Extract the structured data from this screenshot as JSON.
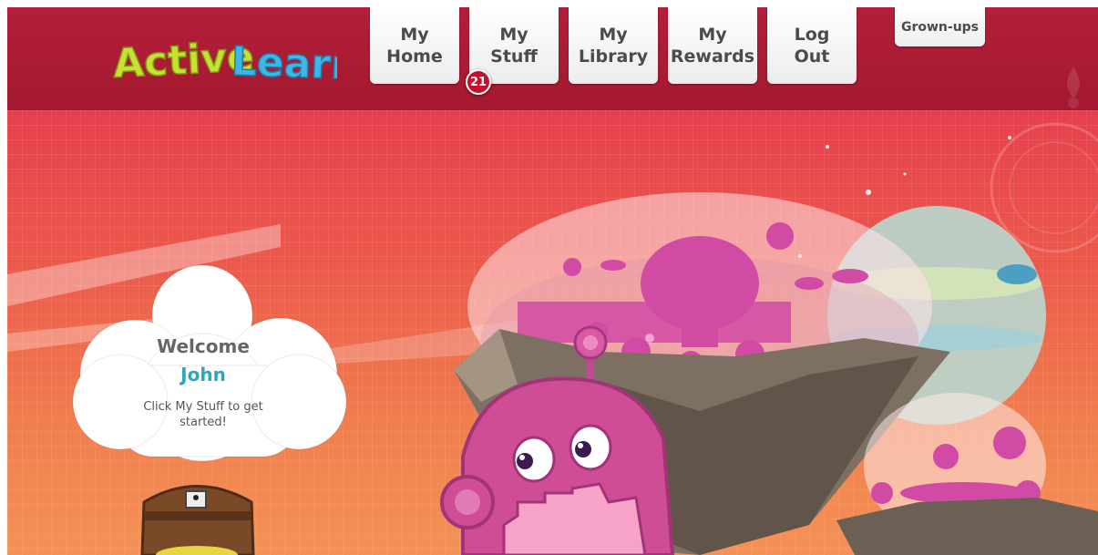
{
  "header": {
    "logo_text": "ActiveLearn",
    "nav": [
      {
        "label": "My\nHome"
      },
      {
        "label": "My\nStuff"
      },
      {
        "label": "My\nLibrary"
      },
      {
        "label": "My\nRewards"
      },
      {
        "label": "Log\nOut"
      }
    ],
    "grownups_label": "Grown-ups",
    "stuff_badge": "21"
  },
  "welcome": {
    "greeting": "Welcome",
    "name": "John",
    "hint": "Click My Stuff to get started!"
  },
  "colors": {
    "header": "#a81b33",
    "accent_name": "#2ba6c4",
    "badge": "#c8102e"
  }
}
